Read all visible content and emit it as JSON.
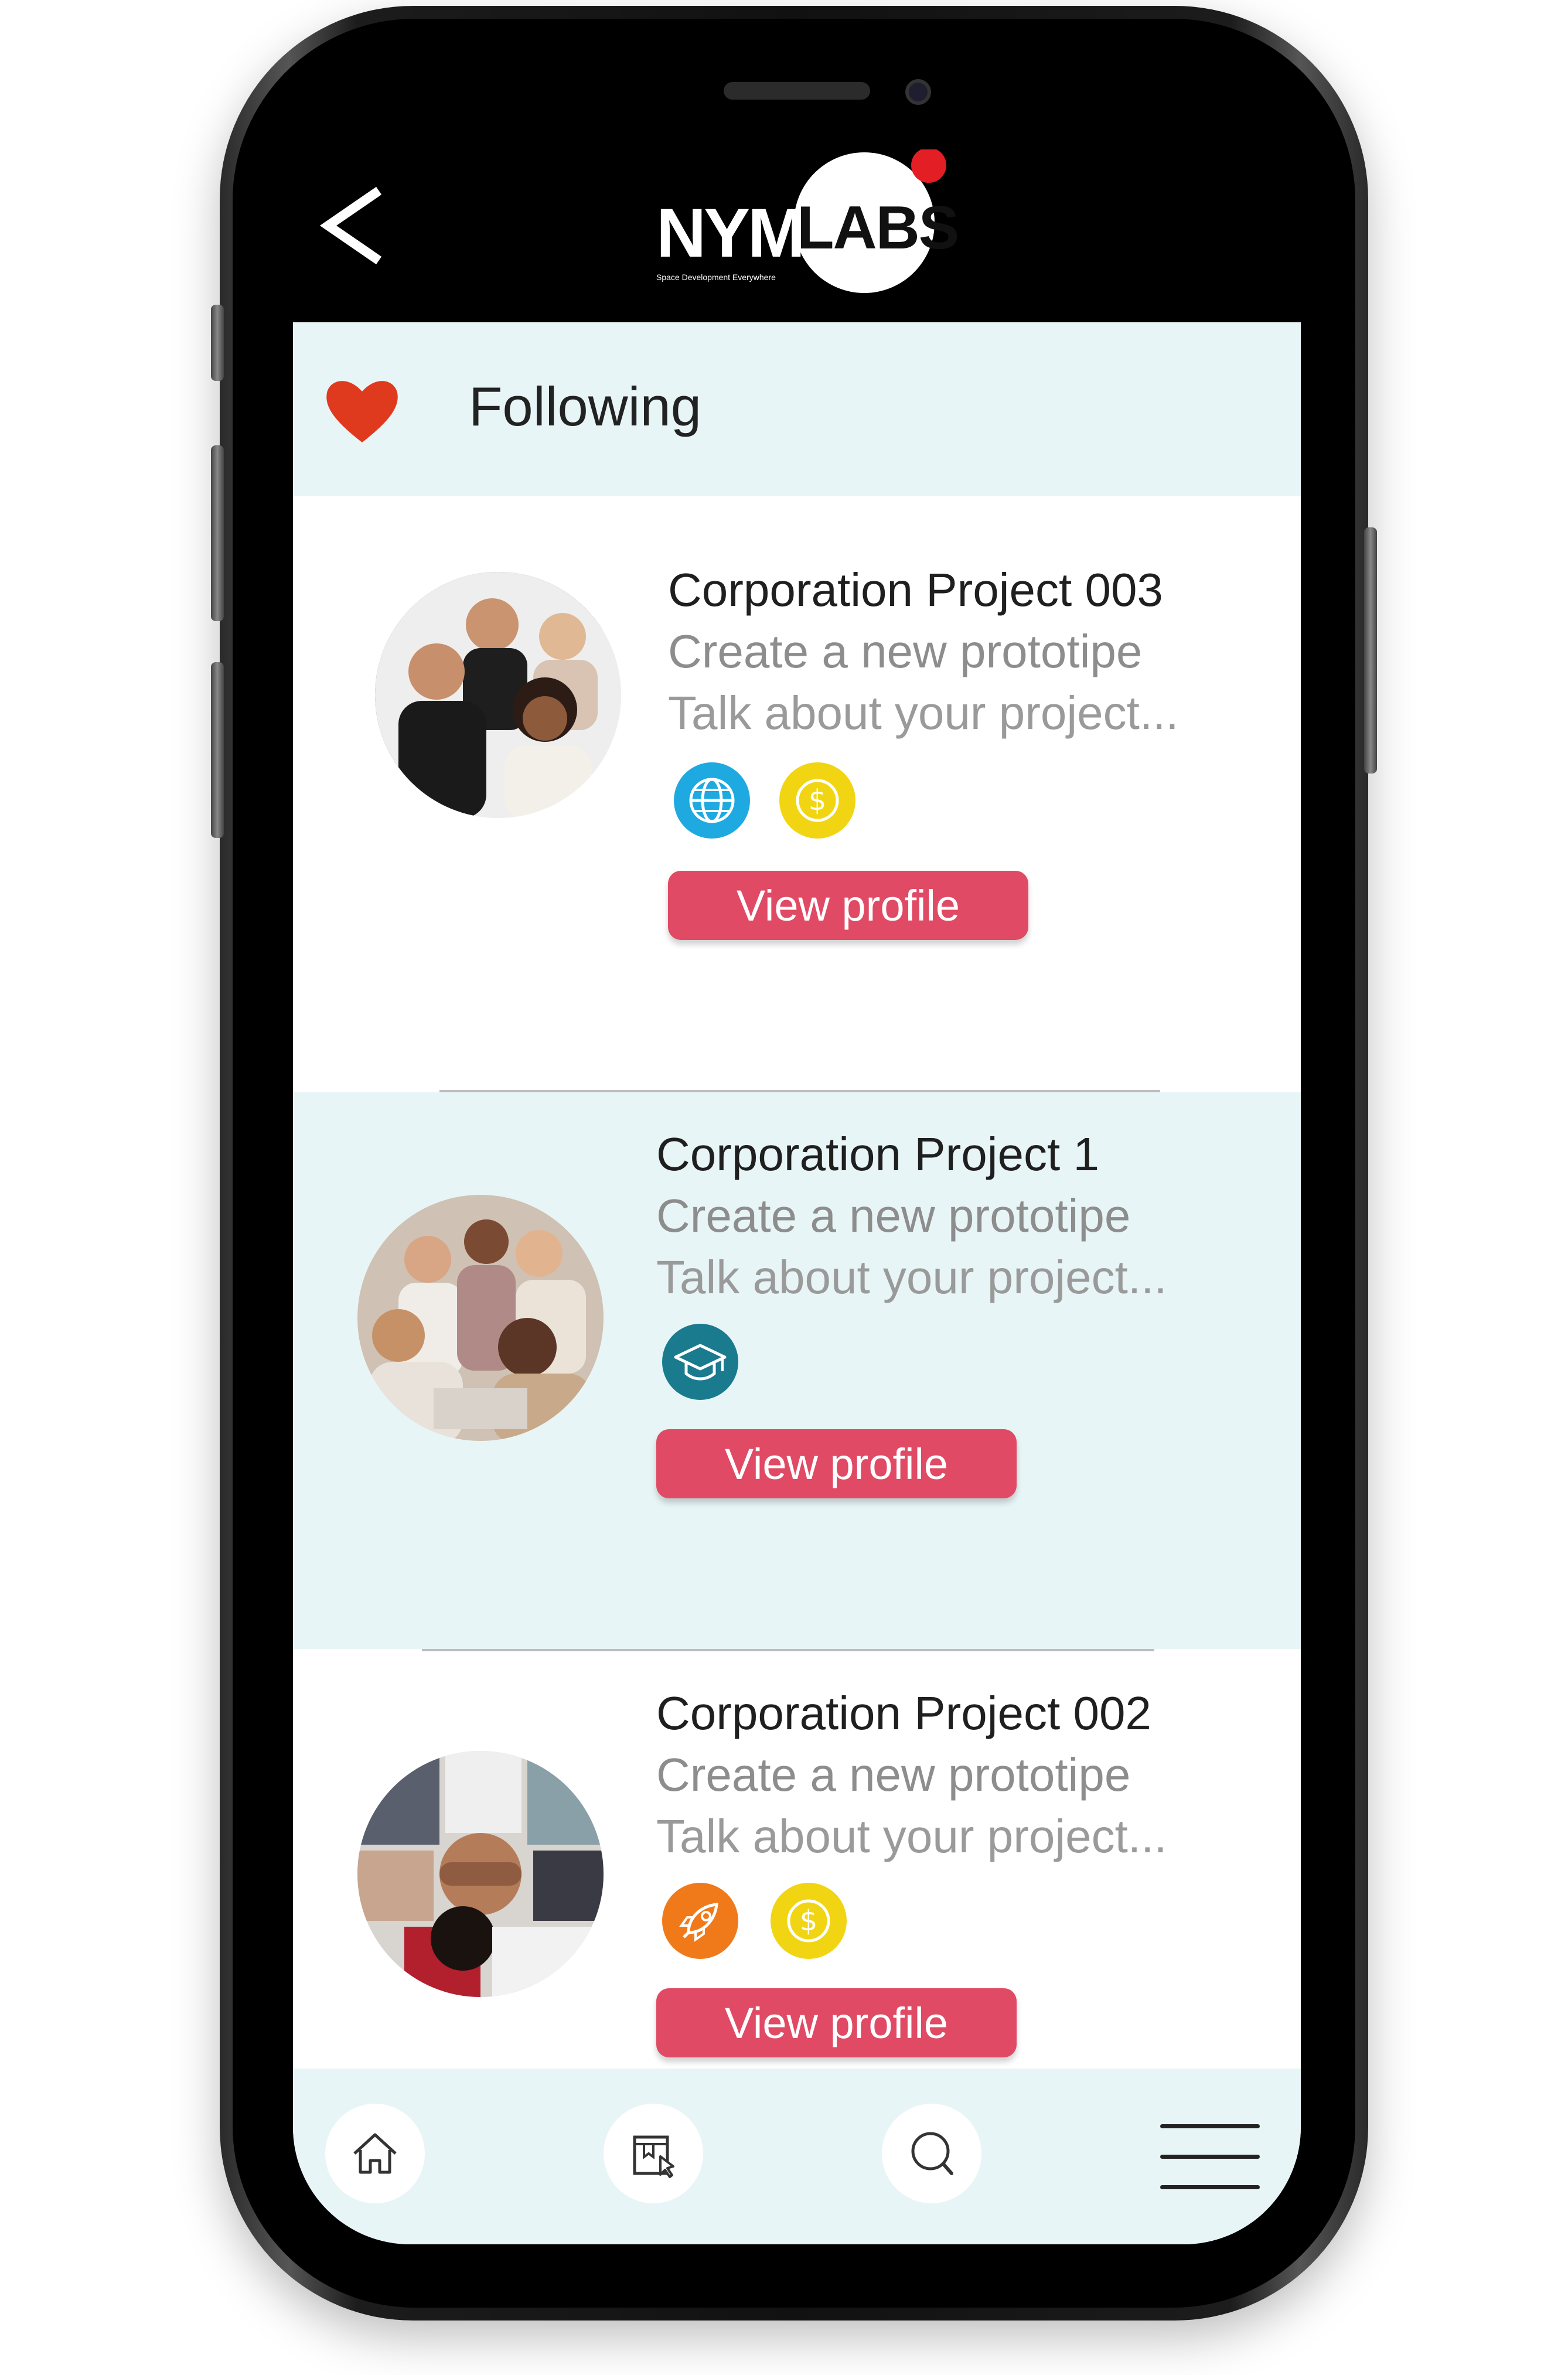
{
  "app": {
    "logo_primary": "NYM",
    "logo_secondary": "LABS",
    "logo_tagline": "Space Development Everywhere"
  },
  "header": {
    "section_title": "Following"
  },
  "cards": [
    {
      "title": "Corporation Project 003",
      "subtitle": "Create a new prototipe",
      "description": "Talk about your project...",
      "tags": [
        "globe-icon",
        "dollar-coin-icon"
      ],
      "button_label": "View profile"
    },
    {
      "title": "Corporation Project 1",
      "subtitle": "Create a new prototipe",
      "description": "Talk about your project...",
      "tags": [
        "graduation-cap-icon"
      ],
      "button_label": "View profile"
    },
    {
      "title": "Corporation Project 002",
      "subtitle": "Create a new prototipe",
      "description": "Talk about your project...",
      "tags": [
        "rocket-icon",
        "dollar-coin-icon"
      ],
      "button_label": "View profile"
    }
  ],
  "bottom_nav": {
    "items": [
      "home-icon",
      "bookmark-board-icon",
      "search-icon",
      "menu-icon"
    ]
  },
  "colors": {
    "accent": "#e04a64",
    "panel": "#e8f5f6",
    "heart": "#e03a1e",
    "globe": "#1ea9e0",
    "coin": "#f1d512",
    "education": "#1a7a8e",
    "rocket": "#f07a1a"
  }
}
